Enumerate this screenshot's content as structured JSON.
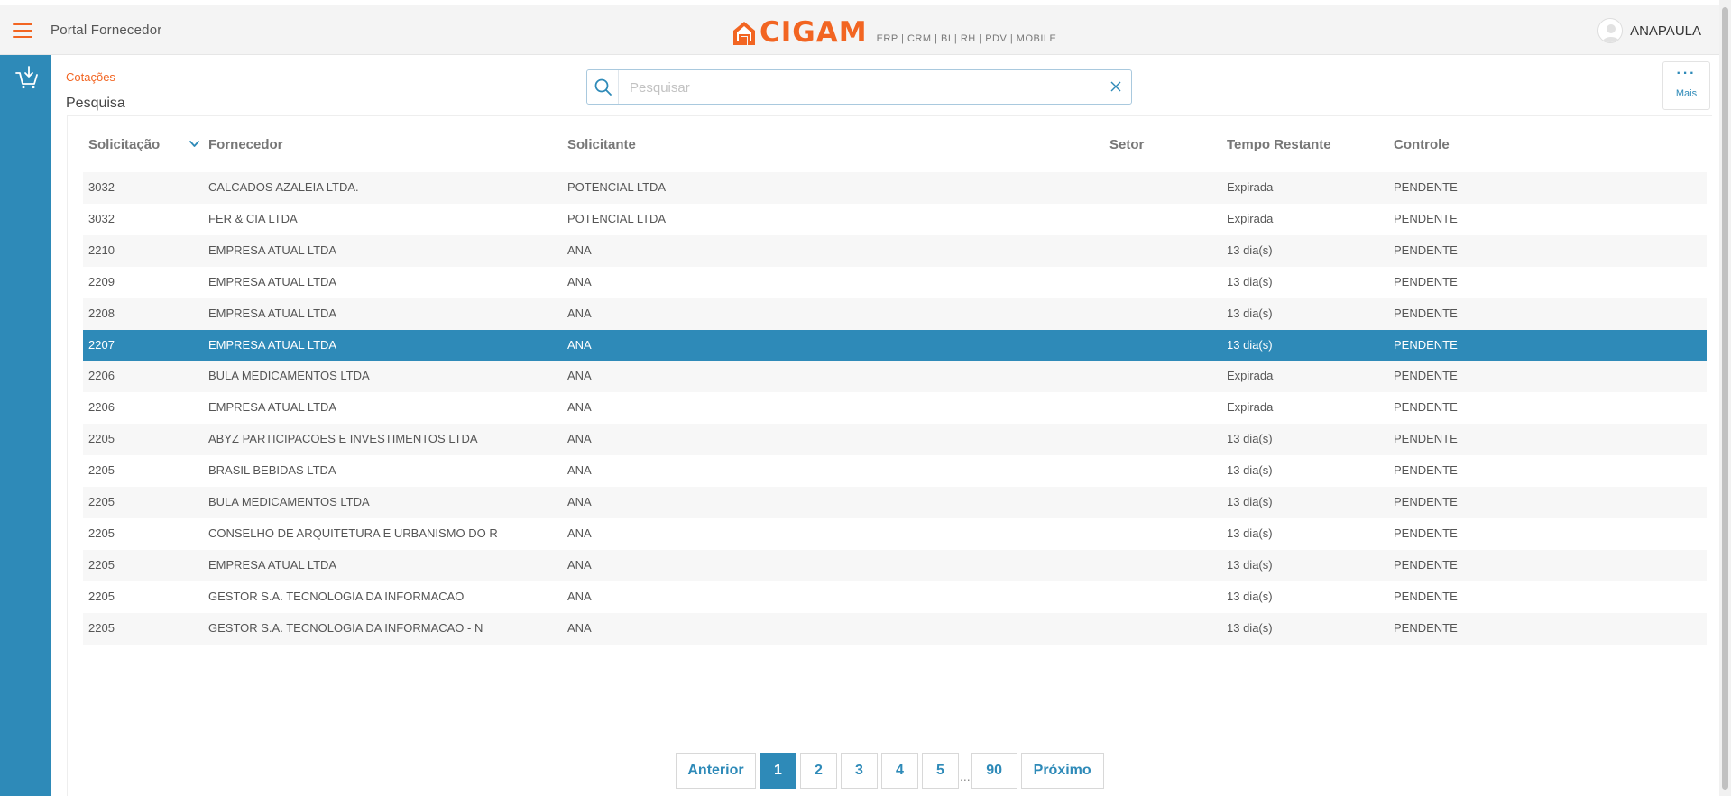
{
  "header": {
    "portal_title": "Portal Fornecedor",
    "logo_text": "CIGAM",
    "logo_tagline": "ERP | CRM | BI | RH | PDV | MOBILE",
    "user_name": "ANAPAULA"
  },
  "breadcrumb": {
    "parent": "Cotações",
    "current": "Pesquisa"
  },
  "search": {
    "placeholder": "Pesquisar",
    "value": ""
  },
  "more": {
    "label": "Mais"
  },
  "table": {
    "columns": [
      "Solicitação",
      "Fornecedor",
      "Solicitante",
      "Setor",
      "Tempo Restante",
      "Controle"
    ],
    "sorted_column": "Fornecedor",
    "sort_direction": "desc",
    "rows": [
      [
        "3032",
        "CALCADOS AZALEIA LTDA.",
        "POTENCIAL LTDA",
        "",
        "Expirada",
        "PENDENTE"
      ],
      [
        "3032",
        "FER & CIA LTDA",
        "POTENCIAL LTDA",
        "",
        "Expirada",
        "PENDENTE"
      ],
      [
        "2210",
        "EMPRESA ATUAL LTDA",
        "ANA",
        "",
        "13 dia(s)",
        "PENDENTE"
      ],
      [
        "2209",
        "EMPRESA ATUAL LTDA",
        "ANA",
        "",
        "13 dia(s)",
        "PENDENTE"
      ],
      [
        "2208",
        "EMPRESA ATUAL LTDA",
        "ANA",
        "",
        "13 dia(s)",
        "PENDENTE"
      ],
      [
        "2207",
        "EMPRESA ATUAL LTDA",
        "ANA",
        "",
        "13 dia(s)",
        "PENDENTE"
      ],
      [
        "2206",
        "BULA MEDICAMENTOS LTDA",
        "ANA",
        "",
        "Expirada",
        "PENDENTE"
      ],
      [
        "2206",
        "EMPRESA ATUAL LTDA",
        "ANA",
        "",
        "Expirada",
        "PENDENTE"
      ],
      [
        "2205",
        "ABYZ PARTICIPACOES E INVESTIMENTOS LTDA",
        "ANA",
        "",
        "13 dia(s)",
        "PENDENTE"
      ],
      [
        "2205",
        "BRASIL BEBIDAS LTDA",
        "ANA",
        "",
        "13 dia(s)",
        "PENDENTE"
      ],
      [
        "2205",
        "BULA MEDICAMENTOS LTDA",
        "ANA",
        "",
        "13 dia(s)",
        "PENDENTE"
      ],
      [
        "2205",
        "CONSELHO DE ARQUITETURA E URBANISMO DO R",
        "ANA",
        "",
        "13 dia(s)",
        "PENDENTE"
      ],
      [
        "2205",
        "EMPRESA ATUAL LTDA",
        "ANA",
        "",
        "13 dia(s)",
        "PENDENTE"
      ],
      [
        "2205",
        "GESTOR S.A. TECNOLOGIA DA INFORMACAO",
        "ANA",
        "",
        "13 dia(s)",
        "PENDENTE"
      ],
      [
        "2205",
        "GESTOR S.A. TECNOLOGIA DA INFORMACAO - N",
        "ANA",
        "",
        "13 dia(s)",
        "PENDENTE"
      ]
    ],
    "selected_row": 5
  },
  "pagination": {
    "prev_label": "Anterior",
    "next_label": "Próximo",
    "pages": [
      "1",
      "2",
      "3",
      "4",
      "5"
    ],
    "ellipsis": "...",
    "last_page": "90",
    "current_page": "1"
  },
  "colors": {
    "accent_orange": "#f26522",
    "primary_blue": "#2e8ab8"
  },
  "icons": {
    "menu": "hamburger-menu-icon",
    "cart": "shopping-cart-download-icon",
    "search": "search-icon",
    "clear": "close-icon",
    "more": "more-dots-icon",
    "user": "user-avatar-icon",
    "sort": "chevron-down-icon"
  }
}
